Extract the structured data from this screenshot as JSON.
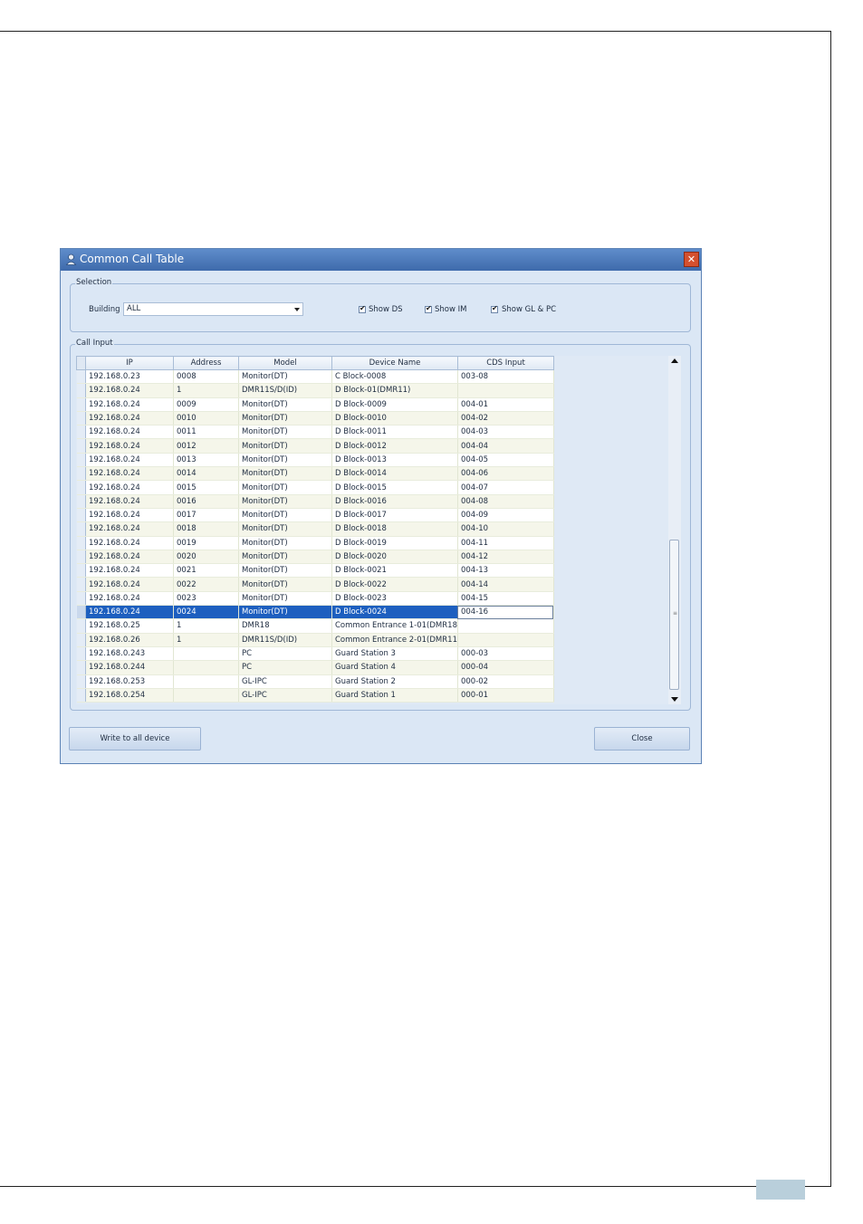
{
  "window": {
    "title": "Common Call Table",
    "title_icon": "user-icon",
    "close_icon": "close-icon"
  },
  "selection": {
    "legend": "Selection",
    "building_label": "Building",
    "building_value": "ALL",
    "checkboxes": [
      {
        "label": "Show DS",
        "checked": true
      },
      {
        "label": "Show IM",
        "checked": true
      },
      {
        "label": "Show GL & PC",
        "checked": true
      }
    ]
  },
  "call_input": {
    "legend": "Call Input",
    "columns": [
      "IP",
      "Address",
      "Model",
      "Device Name",
      "CDS Input"
    ],
    "selected_row": 17,
    "rows": [
      [
        "192.168.0.23",
        "0008",
        "Monitor(DT)",
        "C Block-0008",
        "003-08"
      ],
      [
        "192.168.0.24",
        "1",
        "DMR11S/D(ID)",
        "D Block-01(DMR11)",
        ""
      ],
      [
        "192.168.0.24",
        "0009",
        "Monitor(DT)",
        "D Block-0009",
        "004-01"
      ],
      [
        "192.168.0.24",
        "0010",
        "Monitor(DT)",
        "D Block-0010",
        "004-02"
      ],
      [
        "192.168.0.24",
        "0011",
        "Monitor(DT)",
        "D Block-0011",
        "004-03"
      ],
      [
        "192.168.0.24",
        "0012",
        "Monitor(DT)",
        "D Block-0012",
        "004-04"
      ],
      [
        "192.168.0.24",
        "0013",
        "Monitor(DT)",
        "D Block-0013",
        "004-05"
      ],
      [
        "192.168.0.24",
        "0014",
        "Monitor(DT)",
        "D Block-0014",
        "004-06"
      ],
      [
        "192.168.0.24",
        "0015",
        "Monitor(DT)",
        "D Block-0015",
        "004-07"
      ],
      [
        "192.168.0.24",
        "0016",
        "Monitor(DT)",
        "D Block-0016",
        "004-08"
      ],
      [
        "192.168.0.24",
        "0017",
        "Monitor(DT)",
        "D Block-0017",
        "004-09"
      ],
      [
        "192.168.0.24",
        "0018",
        "Monitor(DT)",
        "D Block-0018",
        "004-10"
      ],
      [
        "192.168.0.24",
        "0019",
        "Monitor(DT)",
        "D Block-0019",
        "004-11"
      ],
      [
        "192.168.0.24",
        "0020",
        "Monitor(DT)",
        "D Block-0020",
        "004-12"
      ],
      [
        "192.168.0.24",
        "0021",
        "Monitor(DT)",
        "D Block-0021",
        "004-13"
      ],
      [
        "192.168.0.24",
        "0022",
        "Monitor(DT)",
        "D Block-0022",
        "004-14"
      ],
      [
        "192.168.0.24",
        "0023",
        "Monitor(DT)",
        "D Block-0023",
        "004-15"
      ],
      [
        "192.168.0.24",
        "0024",
        "Monitor(DT)",
        "D Block-0024",
        "004-16"
      ],
      [
        "192.168.0.25",
        "1",
        "DMR18",
        "Common Entrance 1-01(DMR18",
        ""
      ],
      [
        "192.168.0.26",
        "1",
        "DMR11S/D(ID)",
        "Common Entrance 2-01(DMR11",
        ""
      ],
      [
        "192.168.0.243",
        "",
        "PC",
        "Guard Station 3",
        "000-03"
      ],
      [
        "192.168.0.244",
        "",
        "PC",
        "Guard Station 4",
        "000-04"
      ],
      [
        "192.168.0.253",
        "",
        "GL-IPC",
        "Guard Station 2",
        "000-02"
      ],
      [
        "192.168.0.254",
        "",
        "GL-IPC",
        "Guard Station 1",
        "000-01"
      ]
    ]
  },
  "buttons": {
    "write": "Write to all device",
    "close": "Close"
  }
}
